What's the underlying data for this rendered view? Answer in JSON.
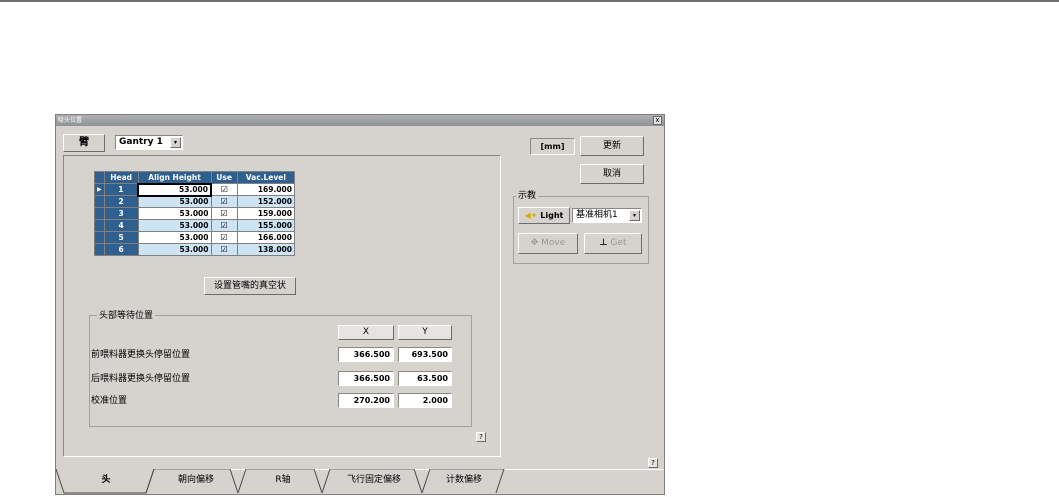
{
  "window": {
    "title": "吸头位置",
    "close": "x"
  },
  "arm": {
    "label": "臂",
    "gantry": "Gantry 1",
    "dd": "▾"
  },
  "grid": {
    "columns": [
      "Head",
      "Align Height",
      "Use",
      "Vac.Level"
    ],
    "rows": [
      {
        "head": "1",
        "align": "53.000",
        "use": "☑",
        "vac": "169.000"
      },
      {
        "head": "2",
        "align": "53.000",
        "use": "☑",
        "vac": "152.000"
      },
      {
        "head": "3",
        "align": "53.000",
        "use": "☑",
        "vac": "159.000"
      },
      {
        "head": "4",
        "align": "53.000",
        "use": "☑",
        "vac": "155.000"
      },
      {
        "head": "5",
        "align": "53.000",
        "use": "☑",
        "vac": "166.000"
      },
      {
        "head": "6",
        "align": "53.000",
        "use": "☑",
        "vac": "138.000"
      }
    ],
    "selector": "▶"
  },
  "vacuum_button": "设置管嘴的真空状",
  "wait_position": {
    "group_label": "头部等待位置",
    "col_x": "X",
    "col_y": "Y",
    "rows": [
      {
        "label": "前喂料器更换头停留位置",
        "x": "366.500",
        "y": "693.500"
      },
      {
        "label": "后喂料器更换头停留位置",
        "x": "366.500",
        "y": "63.500"
      },
      {
        "label": "校准位置",
        "x": "270.200",
        "y": "2.000"
      }
    ]
  },
  "right_panel": {
    "unit": "[mm]",
    "update": "更新",
    "cancel": "取消",
    "teach_label": "示教",
    "light": "Light",
    "camera": "基准相机1",
    "move": "Move",
    "get": "Get"
  },
  "help": "?",
  "tabs": [
    "头",
    "朝向偏移",
    "R轴",
    "飞行固定偏移",
    "计数偏移"
  ]
}
